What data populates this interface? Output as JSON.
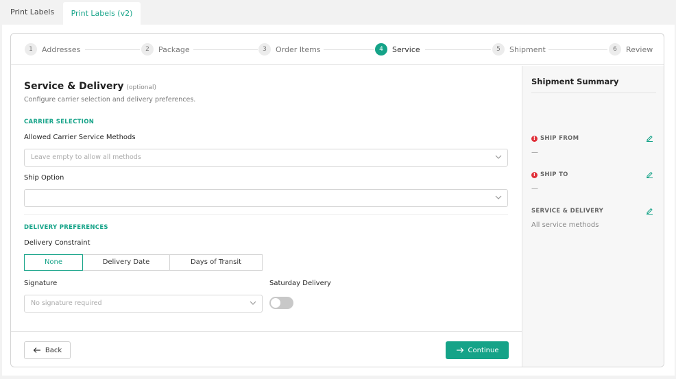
{
  "tabs": [
    {
      "label": "Print Labels",
      "active": false
    },
    {
      "label": "Print Labels (v2)",
      "active": true
    }
  ],
  "steps": [
    {
      "num": "1",
      "label": "Addresses"
    },
    {
      "num": "2",
      "label": "Package"
    },
    {
      "num": "3",
      "label": "Order Items"
    },
    {
      "num": "4",
      "label": "Service",
      "active": true
    },
    {
      "num": "5",
      "label": "Shipment"
    },
    {
      "num": "6",
      "label": "Review"
    }
  ],
  "form": {
    "title": "Service & Delivery",
    "optional": "(optional)",
    "subtitle": "Configure carrier selection and delivery preferences.",
    "carrier_section": "CARRIER SELECTION",
    "carrier_methods_label": "Allowed Carrier Service Methods",
    "carrier_methods_placeholder": "Leave empty to allow all methods",
    "ship_option_label": "Ship Option",
    "ship_option_value": "",
    "delivery_section": "DELIVERY PREFERENCES",
    "delivery_constraint_label": "Delivery Constraint",
    "constraint_options": [
      "None",
      "Delivery Date",
      "Days of Transit"
    ],
    "constraint_selected": "None",
    "signature_label": "Signature",
    "signature_placeholder": "No signature required",
    "saturday_label": "Saturday Delivery",
    "saturday_enabled": false
  },
  "footer": {
    "back_label": "Back",
    "continue_label": "Continue"
  },
  "summary": {
    "title": "Shipment Summary",
    "ship_from_label": "SHIP FROM",
    "ship_from_value": "—",
    "ship_to_label": "SHIP TO",
    "ship_to_value": "—",
    "service_label": "SERVICE & DELIVERY",
    "service_value": "All service methods"
  },
  "colors": {
    "accent": "#15a388",
    "warning": "#e0303a"
  }
}
